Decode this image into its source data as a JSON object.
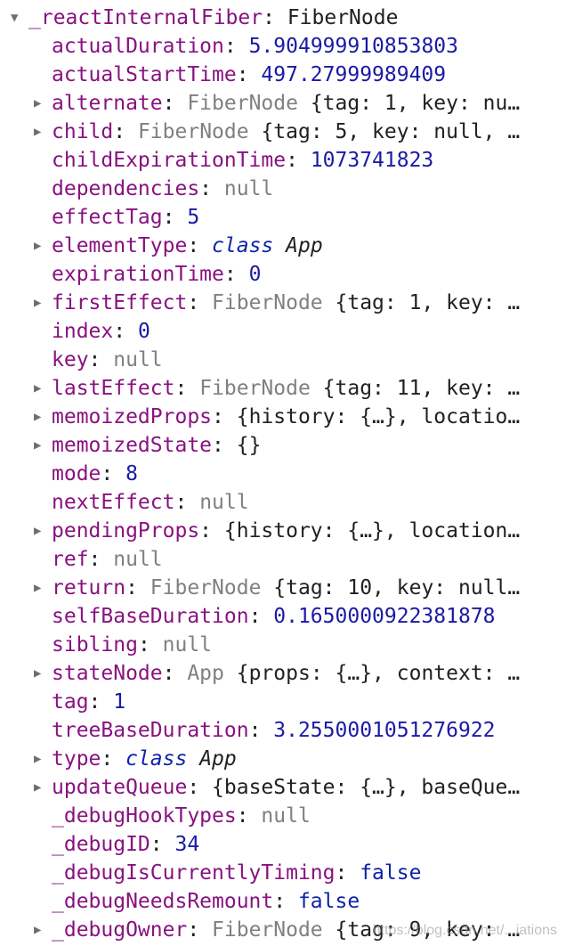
{
  "root": {
    "key": "_reactInternalFiber",
    "value": "FiberNode"
  },
  "rows": [
    {
      "expandable": false,
      "key": "actualDuration",
      "kind": "num",
      "value": "5.904999910853803"
    },
    {
      "expandable": false,
      "key": "actualStartTime",
      "kind": "num",
      "value": "497.27999989409"
    },
    {
      "expandable": true,
      "key": "alternate",
      "kind": "obj",
      "type": "FiberNode",
      "value": "{tag: 1, key: nu…"
    },
    {
      "expandable": true,
      "key": "child",
      "kind": "obj",
      "type": "FiberNode",
      "value": "{tag: 5, key: null, …"
    },
    {
      "expandable": false,
      "key": "childExpirationTime",
      "kind": "num",
      "value": "1073741823"
    },
    {
      "expandable": false,
      "key": "dependencies",
      "kind": "null",
      "value": "null"
    },
    {
      "expandable": false,
      "key": "effectTag",
      "kind": "num",
      "value": "5"
    },
    {
      "expandable": true,
      "key": "elementType",
      "kind": "class",
      "cls": "class",
      "value": "App"
    },
    {
      "expandable": false,
      "key": "expirationTime",
      "kind": "num",
      "value": "0"
    },
    {
      "expandable": true,
      "key": "firstEffect",
      "kind": "obj",
      "type": "FiberNode",
      "value": "{tag: 1, key: …"
    },
    {
      "expandable": false,
      "key": "index",
      "kind": "num",
      "value": "0"
    },
    {
      "expandable": false,
      "key": "key",
      "kind": "null",
      "value": "null"
    },
    {
      "expandable": true,
      "key": "lastEffect",
      "kind": "obj",
      "type": "FiberNode",
      "value": "{tag: 11, key: …"
    },
    {
      "expandable": true,
      "key": "memoizedProps",
      "kind": "txt",
      "value": "{history: {…}, locatio…"
    },
    {
      "expandable": true,
      "key": "memoizedState",
      "kind": "txt",
      "value": "{}"
    },
    {
      "expandable": false,
      "key": "mode",
      "kind": "num",
      "value": "8"
    },
    {
      "expandable": false,
      "key": "nextEffect",
      "kind": "null",
      "value": "null"
    },
    {
      "expandable": true,
      "key": "pendingProps",
      "kind": "txt",
      "value": "{history: {…}, location…"
    },
    {
      "expandable": false,
      "key": "ref",
      "kind": "null",
      "value": "null"
    },
    {
      "expandable": true,
      "key": "return",
      "kind": "obj",
      "type": "FiberNode",
      "value": "{tag: 10, key: null…"
    },
    {
      "expandable": false,
      "key": "selfBaseDuration",
      "kind": "num",
      "value": "0.1650000922381878"
    },
    {
      "expandable": false,
      "key": "sibling",
      "kind": "null",
      "value": "null"
    },
    {
      "expandable": true,
      "key": "stateNode",
      "kind": "obj",
      "type": "App",
      "value": "{props: {…}, context: …"
    },
    {
      "expandable": false,
      "key": "tag",
      "kind": "num",
      "value": "1"
    },
    {
      "expandable": false,
      "key": "treeBaseDuration",
      "kind": "num",
      "value": "3.2550001051276922"
    },
    {
      "expandable": true,
      "key": "type",
      "kind": "class",
      "cls": "class",
      "value": "App"
    },
    {
      "expandable": true,
      "key": "updateQueue",
      "kind": "txt",
      "value": "{baseState: {…}, baseQue…"
    },
    {
      "expandable": false,
      "key": "_debugHookTypes",
      "kind": "null",
      "value": "null"
    },
    {
      "expandable": false,
      "key": "_debugID",
      "kind": "num",
      "value": "34"
    },
    {
      "expandable": false,
      "key": "_debugIsCurrentlyTiming",
      "kind": "kw",
      "value": "false"
    },
    {
      "expandable": false,
      "key": "_debugNeedsRemount",
      "kind": "kw",
      "value": "false"
    },
    {
      "expandable": true,
      "key": "_debugOwner",
      "kind": "obj",
      "type": "FiberNode",
      "value": "{tag: 9, key: …"
    }
  ],
  "watermark": "https://blog.csdn.net/...iations",
  "icons": {
    "collapsed": "triangle-right-icon",
    "expanded": "triangle-down-icon"
  },
  "colors": {
    "property_key": "#881280",
    "number": "#1a1aa6",
    "keyword": "#0d22aa",
    "null": "#808080",
    "type_name": "#808080"
  }
}
